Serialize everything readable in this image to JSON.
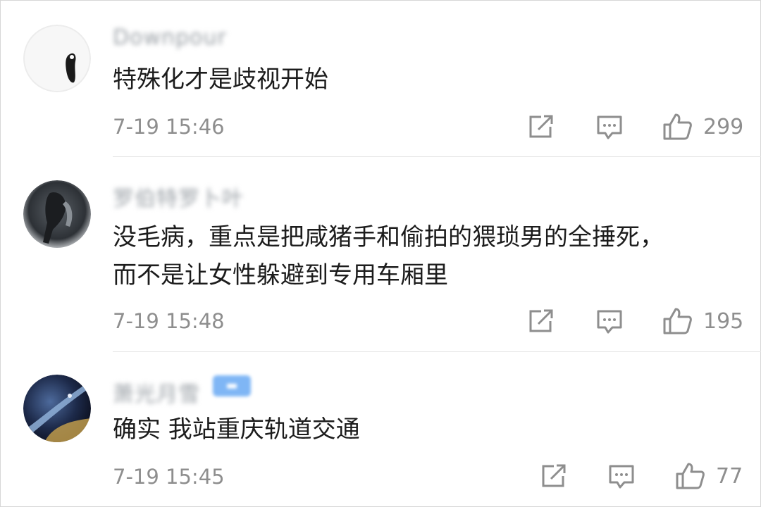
{
  "comments": [
    {
      "username": "Downpour",
      "text_lines": [
        "特殊化才是歧视开始"
      ],
      "time": "7-19 15:46",
      "likes": "299"
    },
    {
      "username": "罗伯特罗卜叶",
      "text_lines": [
        "没毛病，重点是把咸猪手和偷拍的猥琐男的全捶死，",
        "而不是让女性躲避到专用车厢里"
      ],
      "time": "7-19 15:48",
      "likes": "195"
    },
    {
      "username": "萧光月雪",
      "text_lines": [
        "确实 我站重庆轨道交通"
      ],
      "time": "7-19 15:45",
      "likes": "77"
    }
  ],
  "colors": {
    "text": "#1c1c1c",
    "meta": "#8e8e8e",
    "icon": "#8e8e8e",
    "divider": "#e6e6e6"
  },
  "icons": {
    "share": "share-icon",
    "reply": "comment-icon",
    "like": "thumbs-up-icon"
  }
}
